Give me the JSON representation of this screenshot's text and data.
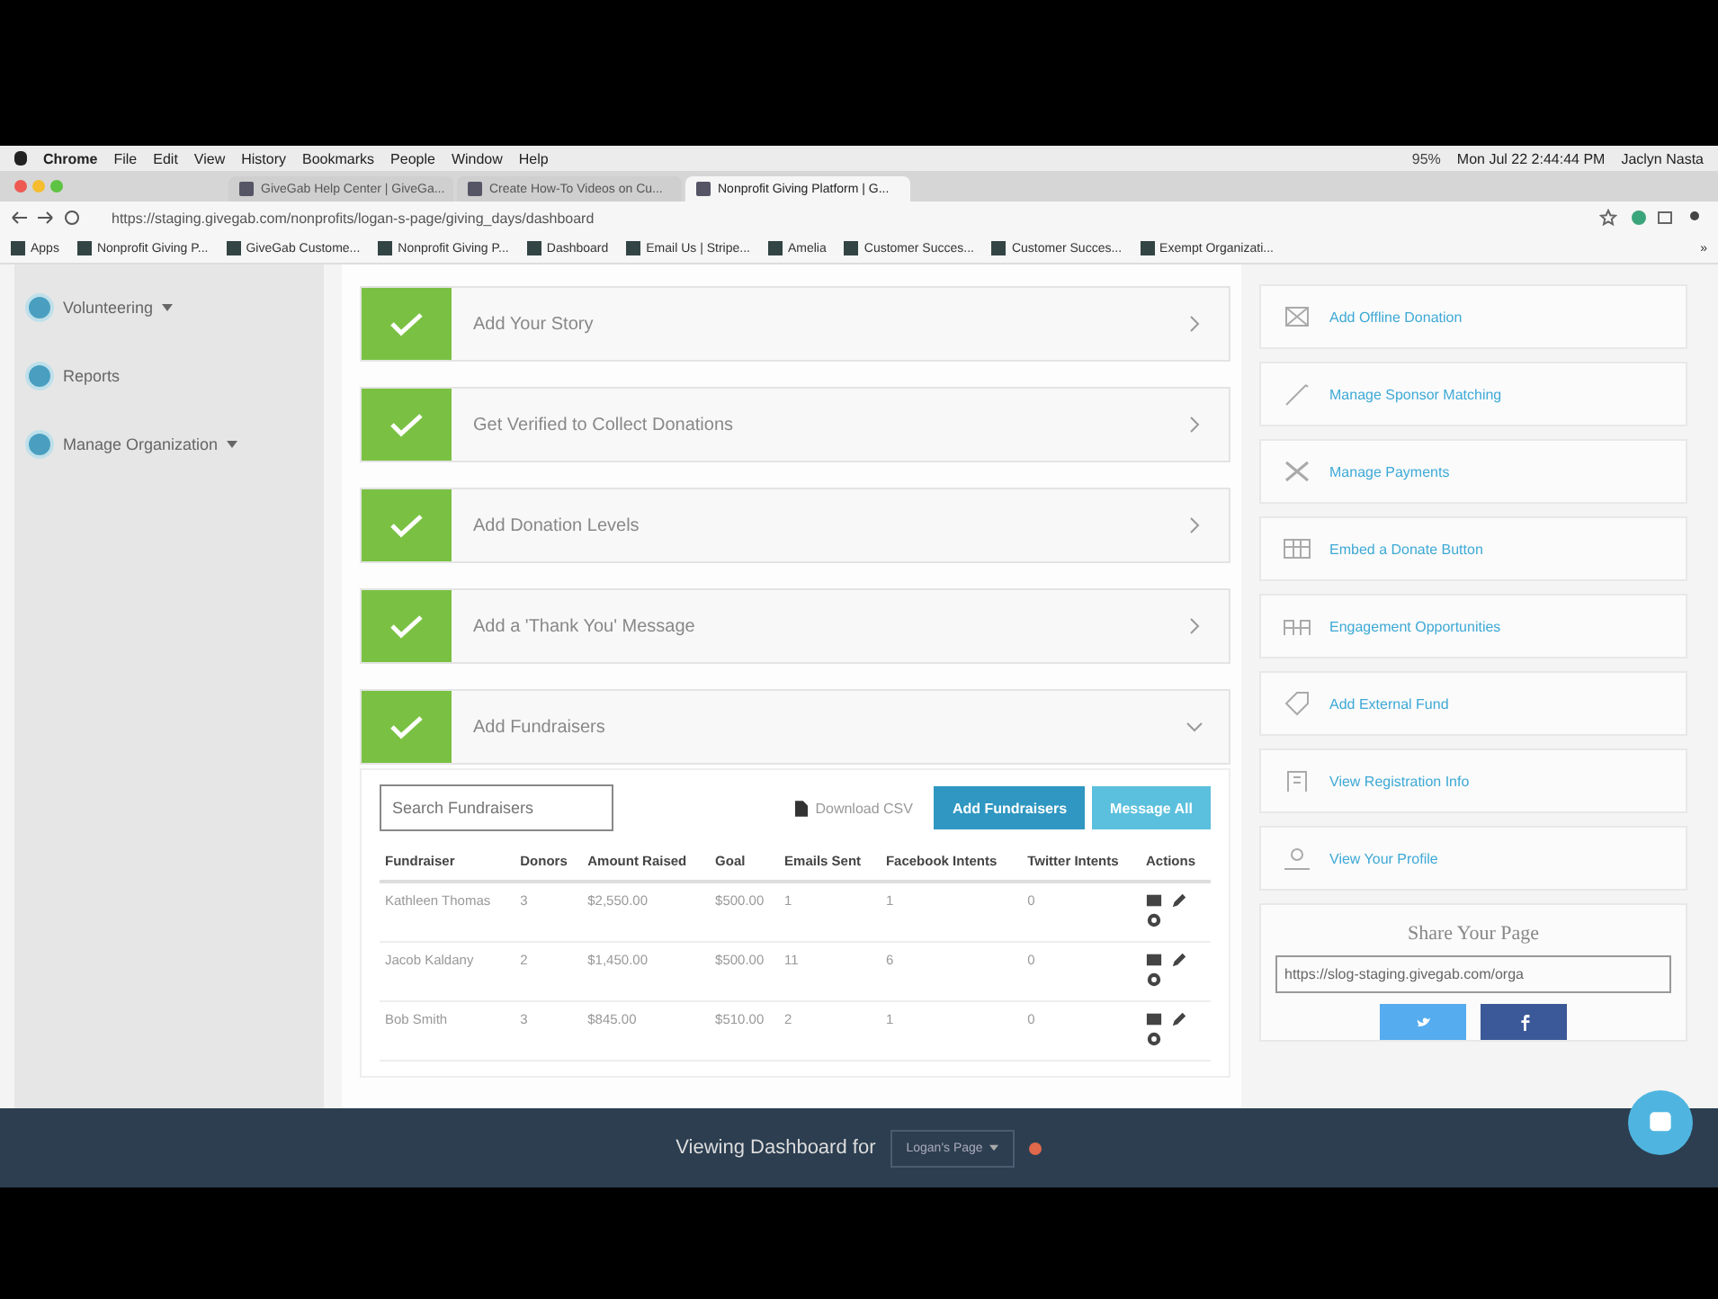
{
  "menu_bar": {
    "app": "Chrome",
    "items": [
      "File",
      "Edit",
      "View",
      "History",
      "Bookmarks",
      "People",
      "Window",
      "Help"
    ],
    "battery": "95%",
    "clock": "Mon Jul 22 2:44:44 PM",
    "user": "Jaclyn Nasta"
  },
  "tabs": [
    {
      "title": "GiveGab Help Center | GiveGa...",
      "selected": false
    },
    {
      "title": "Create How-To Videos on Cu...",
      "selected": false
    },
    {
      "title": "Nonprofit Giving Platform | G...",
      "selected": true
    }
  ],
  "address_bar": {
    "url": "https://staging.givegab.com/nonprofits/logan-s-page/giving_days/dashboard"
  },
  "bookmarks": [
    "Apps",
    "Nonprofit Giving P...",
    "GiveGab Custome...",
    "Nonprofit Giving P...",
    "Dashboard",
    "Email Us | Stripe...",
    "Amelia",
    "Customer Succes...",
    "Customer Succes...",
    "Exempt Organizati..."
  ],
  "bookmarks_more": "»",
  "sidebar": {
    "items": [
      {
        "label": "Volunteering",
        "expandable": true
      },
      {
        "label": "Reports",
        "expandable": false
      },
      {
        "label": "Manage Organization",
        "expandable": true
      }
    ]
  },
  "steps": [
    {
      "label": "Add Your Story",
      "completed": true,
      "expanded": false
    },
    {
      "label": "Get Verified to Collect Donations",
      "completed": true,
      "expanded": false
    },
    {
      "label": "Add Donation Levels",
      "completed": true,
      "expanded": false
    },
    {
      "label": "Add a 'Thank You' Message",
      "completed": true,
      "expanded": false
    },
    {
      "label": "Add Fundraisers",
      "completed": true,
      "expanded": true
    }
  ],
  "fundraisers": {
    "search_placeholder": "Search Fundraisers",
    "download": "Download CSV",
    "buttons": [
      "Add Fundraisers",
      "Message All"
    ],
    "columns": [
      "Fundraiser",
      "Donors",
      "Amount Raised",
      "Goal",
      "Emails Sent",
      "Facebook Intents",
      "Twitter Intents",
      "Actions"
    ],
    "rows": [
      [
        "Kathleen Thomas",
        "3",
        "$2,550.00",
        "$500.00",
        "1",
        "1",
        "0"
      ],
      [
        "Jacob Kaldany",
        "2",
        "$1,450.00",
        "$500.00",
        "11",
        "6",
        "0"
      ],
      [
        "Bob Smith",
        "3",
        "$845.00",
        "$510.00",
        "2",
        "1",
        "0"
      ]
    ]
  },
  "actions": [
    "Add Offline Donation",
    "Manage Sponsor Matching",
    "Manage Payments",
    "Embed a Donate Button",
    "Engagement Opportunities",
    "Add External Fund",
    "View Registration Info",
    "View Your Profile"
  ],
  "share": {
    "title": "Share Your Page",
    "url": "https://slog-staging.givegab.com/orga"
  },
  "viewing_bar": {
    "label": "Viewing Dashboard for",
    "page": "Logan's Page"
  }
}
